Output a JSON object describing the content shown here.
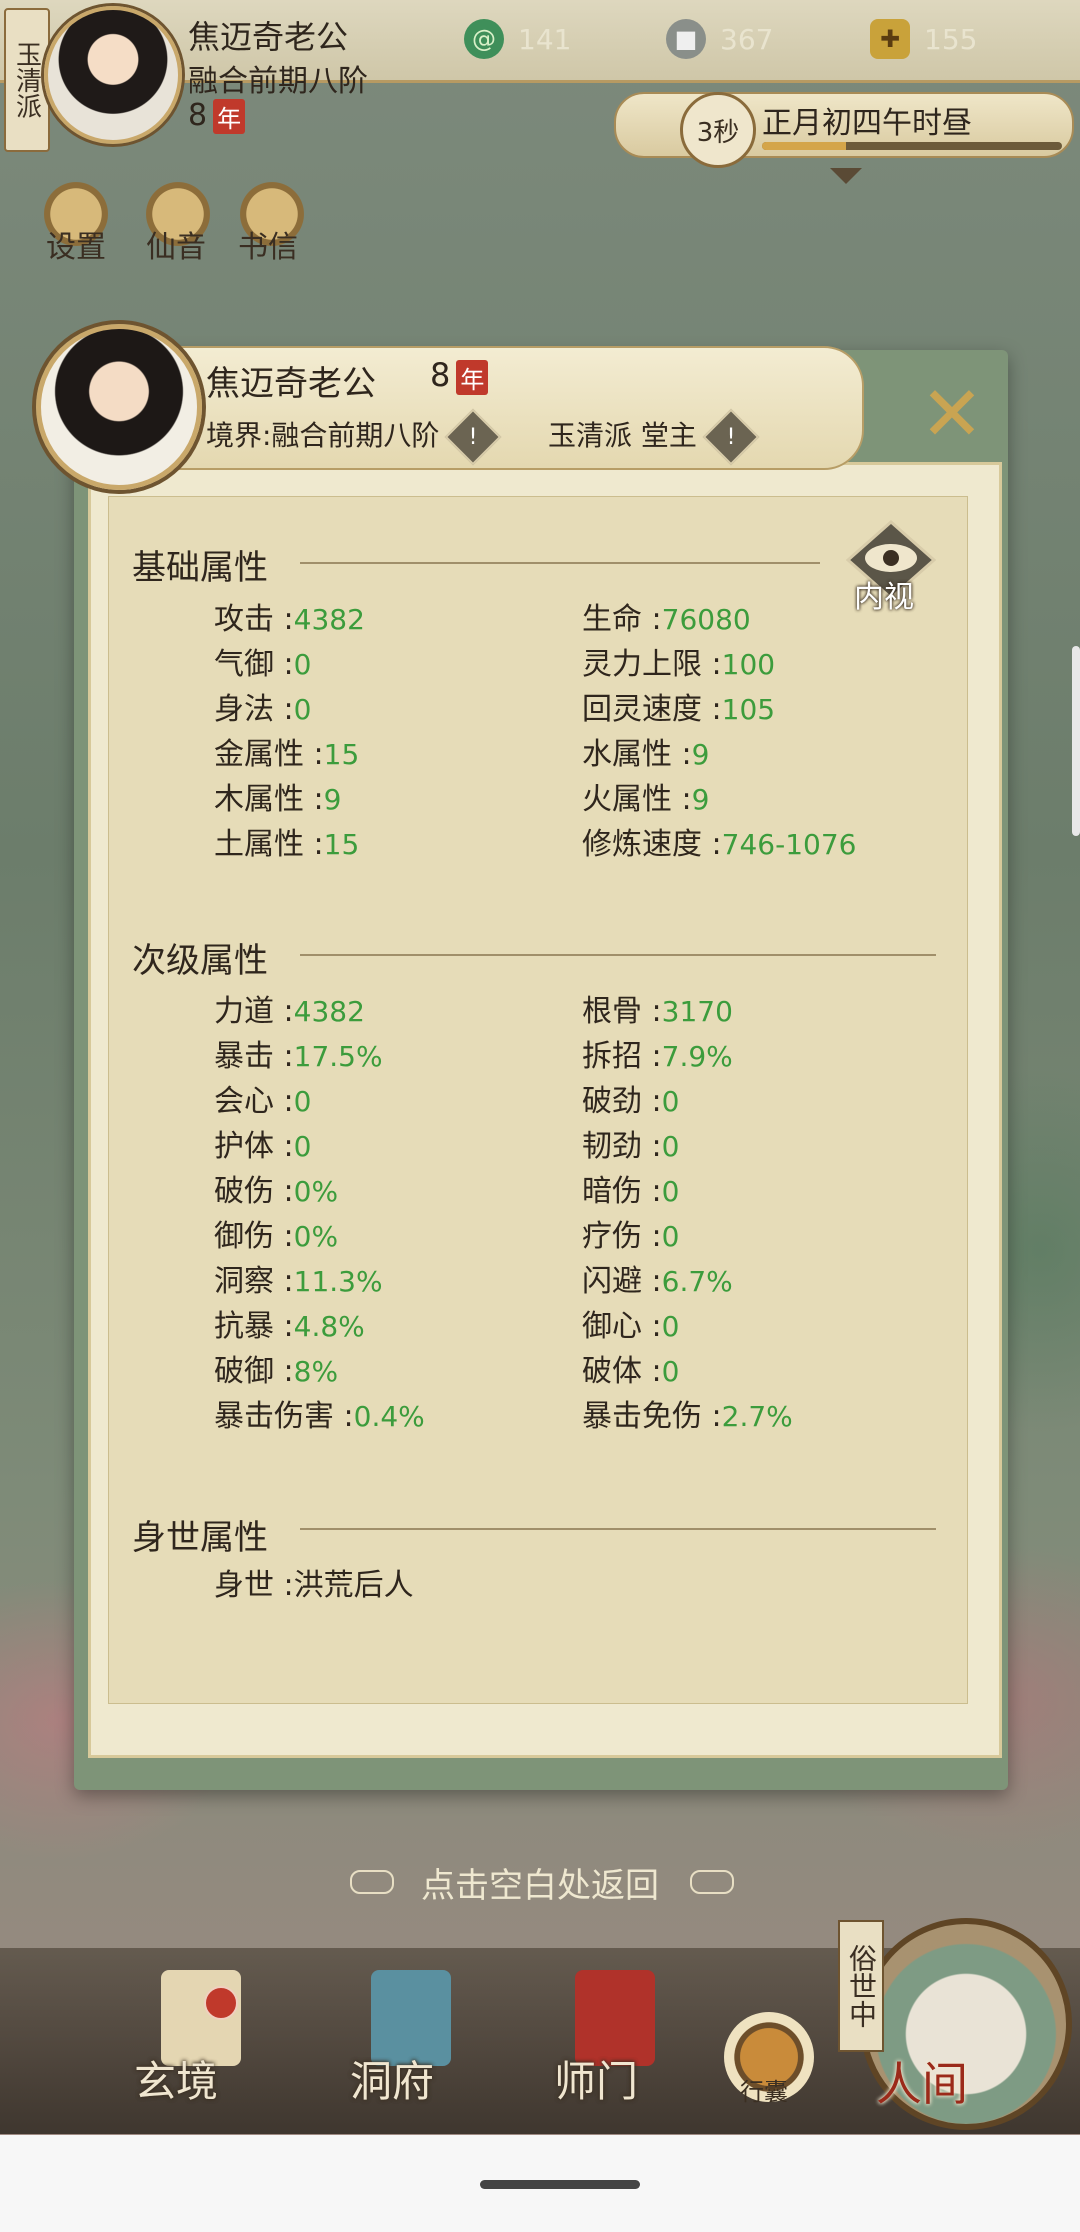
{
  "top": {
    "sect_tag": "玉清派",
    "name": "焦迈奇老公",
    "realm": "融合前期八阶",
    "years": "8",
    "year_unit": "年",
    "resources": [
      {
        "icon": "jade-swirl-icon",
        "value": "141"
      },
      {
        "icon": "coin-icon",
        "value": "367"
      },
      {
        "icon": "gold-ingot-icon",
        "value": "155"
      }
    ],
    "timer": "3秒",
    "time_text": "正月初四午时昼",
    "time_progress": 0.28,
    "tools": [
      "设置",
      "仙音",
      "书信"
    ]
  },
  "panel": {
    "name": "焦迈奇老公",
    "years": "8",
    "year_unit": "年",
    "realm_label": "境界:融合前期八阶",
    "sect_label": "玉清派 堂主",
    "warn_mark": "!",
    "inner_view": "内视",
    "basic_title": "基础属性",
    "basic": [
      [
        "攻击",
        "4382"
      ],
      [
        "生命",
        "76080"
      ],
      [
        "气御",
        "0"
      ],
      [
        "灵力上限",
        "100"
      ],
      [
        "身法",
        "0"
      ],
      [
        "回灵速度",
        "105"
      ],
      [
        "金属性",
        "15"
      ],
      [
        "水属性",
        "9"
      ],
      [
        "木属性",
        "9"
      ],
      [
        "火属性",
        "9"
      ],
      [
        "土属性",
        "15"
      ],
      [
        "修炼速度",
        "746-1076"
      ]
    ],
    "secondary_title": "次级属性",
    "secondary": [
      [
        "力道",
        "4382"
      ],
      [
        "根骨",
        "3170"
      ],
      [
        "暴击",
        "17.5%"
      ],
      [
        "拆招",
        "7.9%"
      ],
      [
        "会心",
        "0"
      ],
      [
        "破劲",
        "0"
      ],
      [
        "护体",
        "0"
      ],
      [
        "韧劲",
        "0"
      ],
      [
        "破伤",
        "0%"
      ],
      [
        "暗伤",
        "0"
      ],
      [
        "御伤",
        "0%"
      ],
      [
        "疗伤",
        "0"
      ],
      [
        "洞察",
        "11.3%"
      ],
      [
        "闪避",
        "6.7%"
      ],
      [
        "抗暴",
        "4.8%"
      ],
      [
        "御心",
        "0"
      ],
      [
        "破御",
        "8%"
      ],
      [
        "破体",
        "0"
      ],
      [
        "暴击伤害",
        "0.4%"
      ],
      [
        "暴击免伤",
        "2.7%"
      ]
    ],
    "origin_title": "身世属性",
    "origin": [
      [
        "身世",
        "洪荒后人"
      ]
    ]
  },
  "back_hint": "点击空白处返回",
  "nav": {
    "items": [
      "玄境",
      "洞府",
      "师门"
    ],
    "bag": "行囊",
    "world_tag": "俗世中",
    "world": "人间"
  },
  "colors": {
    "value_green": "#3c9c3c",
    "accent_red": "#c0392b",
    "gold": "#c9a452"
  }
}
